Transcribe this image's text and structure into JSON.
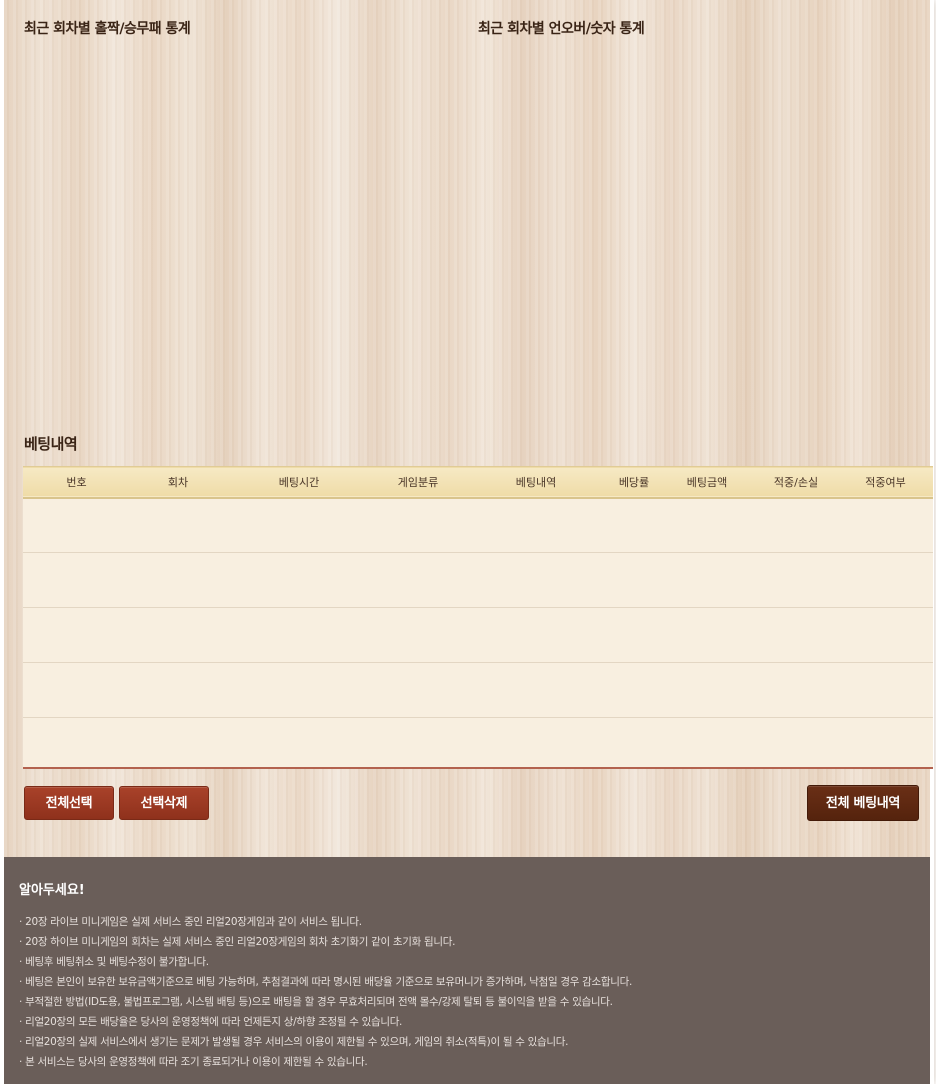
{
  "stats": {
    "left_title": "최근 회차별 홀짝/승무패 통계",
    "right_title": "최근 회차별 언오버/숫자 통계"
  },
  "betting": {
    "title": "베팅내역",
    "columns": [
      "번호",
      "회차",
      "베팅시간",
      "게임분류",
      "베팅내역",
      "베당률",
      "베팅금액",
      "적중/손실",
      "적중여부"
    ],
    "rows": []
  },
  "buttons": {
    "select_all": "전체선택",
    "delete_selected": "선택삭제",
    "all_history": "전체 베팅내역"
  },
  "notice": {
    "title": "알아두세요!",
    "items": [
      "20장 라이브 미니게임은 실제 서비스 중인 리얼20장게임과 같이 서비스 됩니다.",
      "20장 하이브 미니게임의 회차는 실제 서비스 중인 리얼20장게임의 회차 초기화기 같이 초기화 됩니다.",
      "베팅후 베팅취소 및 베팅수정이 불가합니다.",
      "베팅은 본인이 보유한 보유금액기준으로 베팅 가능하며, 추첨결과에 따라 명시된 배당율 기준으로 보유머니가 증가하며, 낙첨일 경우 감소합니다.",
      "부적절한 방법(ID도용, 불법프로그램, 시스템 배팅 등)으로 배팅을 할 경우 무효처리되며 전액 몰수/강제 탈퇴 등 불이익을 받을 수 있습니다.",
      "리얼20장의 모든 배당율은 당사의 운영정책에 따라 언제든지 상/하향 조정될 수 있습니다.",
      "리얼20장의 실제 서비스에서 생기는 문제가 발생될 경우 서비스의 이용이 제한될 수 있으며, 게임의 취소(적특)이 될 수 있습니다.",
      "본 서비스는 당사의 운영정책에 따라 조기 종료되거나 이용이 제한될 수 있습니다."
    ]
  }
}
